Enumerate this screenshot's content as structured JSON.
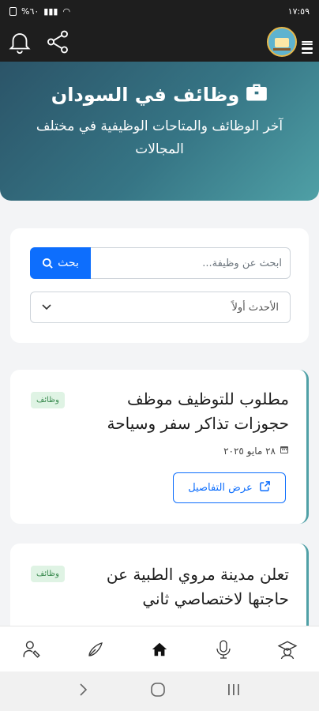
{
  "status_bar": {
    "time": "١٧:٥٩",
    "battery": "%٦٠"
  },
  "hero": {
    "title": "وظائف في السودان",
    "subtitle": "آخر الوظائف والمتاحات الوظيفية في مختلف المجالات"
  },
  "search": {
    "placeholder": "ابحث عن وظيفة...",
    "button_label": "بحث",
    "sort_value": "الأحدث أولاً"
  },
  "jobs": [
    {
      "badge": "وظائف",
      "title": "مطلوب للتوظيف موظف حجوزات تذاكر سفر وسياحة",
      "date": "٢٨ مايو ٢٠٢٥",
      "details_label": "عرض التفاصيل"
    },
    {
      "badge": "وظائف",
      "title": "تعلن مدينة مروي الطبية عن حاجتها لاختصاصي ثاني"
    }
  ],
  "colors": {
    "accent": "#0d6efd",
    "hero_start": "#2b5468",
    "hero_end": "#4fa0a6",
    "badge_bg": "#dff3e4"
  }
}
